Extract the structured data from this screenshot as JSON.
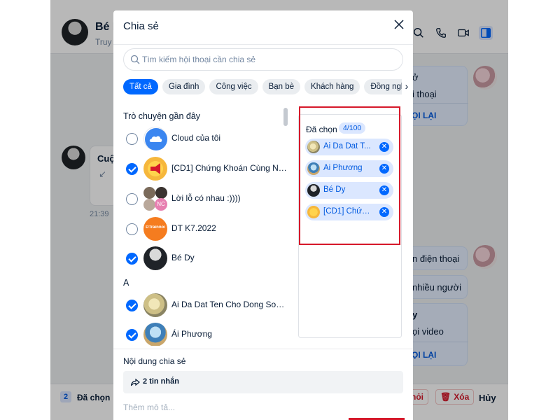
{
  "background_app": {
    "contact_name": "Bé D",
    "contact_status": "Truy",
    "messages": {
      "right_top": {
        "line1": "ở",
        "line2": "i thoại",
        "redo": "ỌI LẠI"
      },
      "left_call": {
        "title": "Cuộ",
        "time": "21:39"
      },
      "right_mid1": "n điện thoại",
      "right_mid2": "nhiều người",
      "right_bottom": {
        "line1": "y",
        "line2": "ọi video",
        "redo": "ỌI LẠI"
      }
    },
    "footer": {
      "selected_count": "2",
      "selected_label": "Đã chọn",
      "hoi_label": "hỏi",
      "delete_label": "Xóa",
      "cancel_label": "Hủy"
    }
  },
  "modal": {
    "title": "Chia sẻ",
    "search_placeholder": "Tìm kiếm hội thoại cần chia sẻ",
    "filters": [
      "Tất cả",
      "Gia đình",
      "Công việc",
      "Bạn bè",
      "Khách hàng",
      "Đồng nghiệ"
    ],
    "recent_label": "Trò chuyện gần đây",
    "recent": [
      {
        "name": "Cloud của tôi",
        "checked": false
      },
      {
        "name": "[CD1] Chứng Khoán Cùng NMT",
        "checked": true
      },
      {
        "name": "Lời lỗ có nhau :))))",
        "checked": false
      },
      {
        "name": "DT K7.2022",
        "checked": false
      },
      {
        "name": "Bé Dy",
        "checked": true
      }
    ],
    "group_badge": "NC",
    "dt_logo_text": "DTrainnoi",
    "alpha_label": "A",
    "alpha_contacts": [
      {
        "name": "Ai Da Dat Ten Cho Dong Song ...",
        "checked": true
      },
      {
        "name": "Ái Phương",
        "checked": true
      }
    ],
    "selected_label": "Đã chọn",
    "selected_count": "4/100",
    "selected": [
      {
        "name": "Ai Da Dat T..."
      },
      {
        "name": "Ái Phương"
      },
      {
        "name": "Bé Dy"
      },
      {
        "name": "[CD1] Chứn..."
      }
    ],
    "share_content_label": "Nội dung chia sẻ",
    "share_item": "2 tin nhắn",
    "description_placeholder": "Thêm mô tả..."
  },
  "colors": {
    "accent": "#0068ff",
    "highlight_box": "#d6182a",
    "chip_selected_bg": "#dbe7ff"
  }
}
